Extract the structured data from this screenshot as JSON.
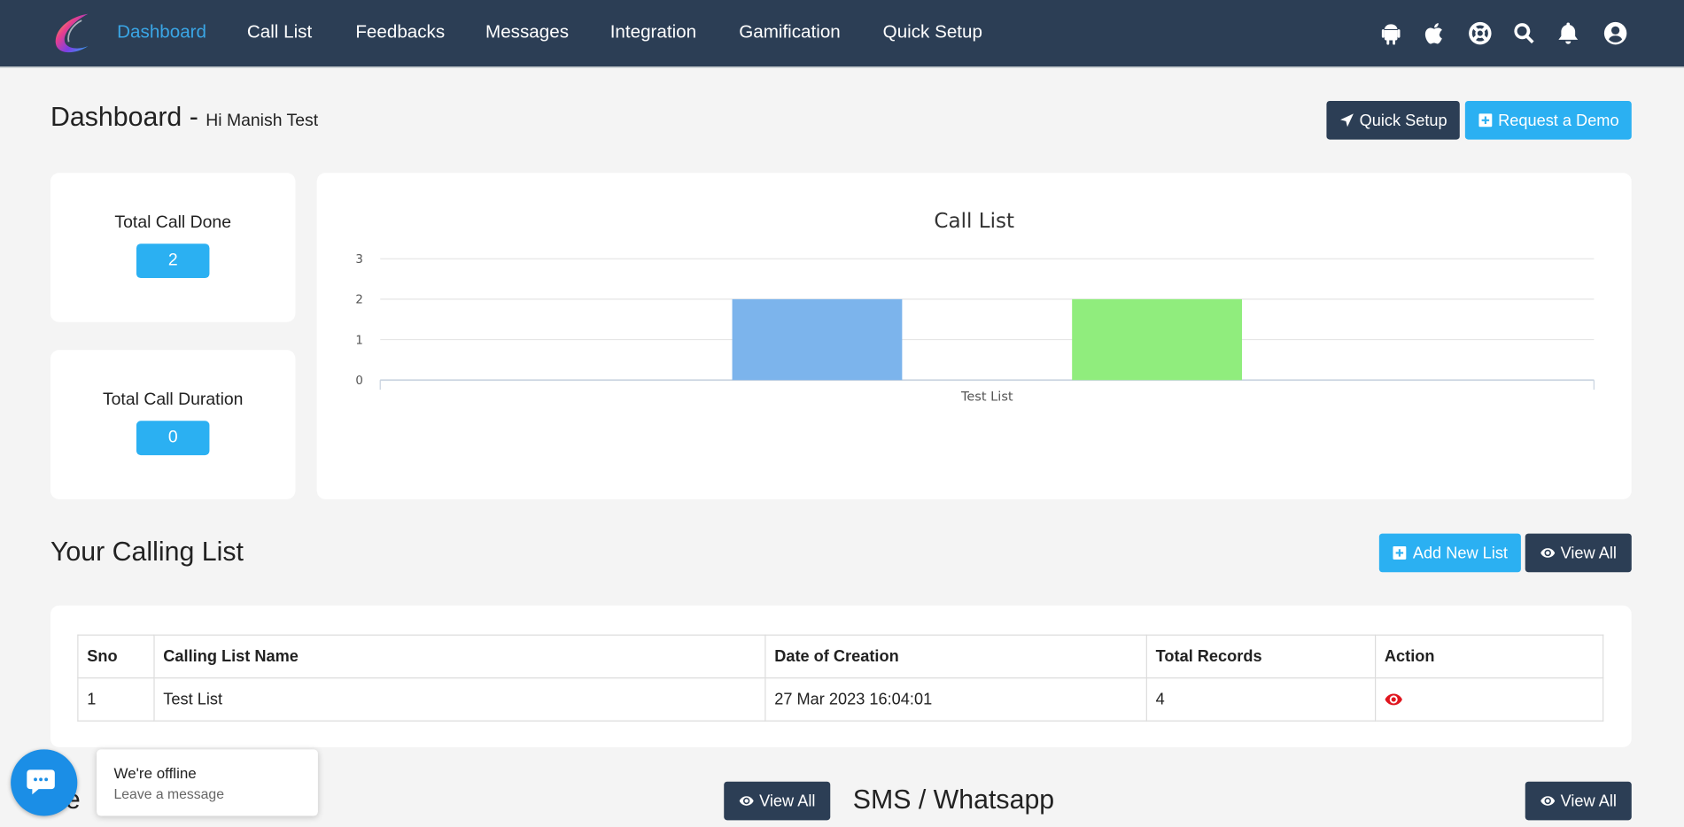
{
  "nav": {
    "items": [
      "Dashboard",
      "Call List",
      "Feedbacks",
      "Messages",
      "Integration",
      "Gamification",
      "Quick Setup"
    ],
    "icons": [
      "android-icon",
      "apple-icon",
      "support-icon",
      "search-icon",
      "bell-icon",
      "user-icon"
    ]
  },
  "header": {
    "title": "Dashboard -",
    "greeting": "Hi Manish Test",
    "quick_setup": "Quick Setup",
    "request_demo": "Request a Demo"
  },
  "stats": {
    "total_call_done_label": "Total Call Done",
    "total_call_done_value": "2",
    "total_call_duration_label": "Total Call Duration",
    "total_call_duration_value": "0"
  },
  "chart_data": {
    "type": "bar",
    "title": "Call List",
    "categories": [
      "Test List"
    ],
    "series": [
      {
        "values": [
          2
        ],
        "color": "#7cb4ec"
      },
      {
        "values": [
          2
        ],
        "color": "#90ed7d"
      }
    ],
    "yticks": [
      "0",
      "1",
      "2",
      "3"
    ],
    "ylim": [
      0,
      3
    ],
    "grid": true
  },
  "calling_list": {
    "title": "Your Calling List",
    "add_new": "Add New List",
    "view_all": "View All",
    "columns": [
      "Sno",
      "Calling List Name",
      "Date of Creation",
      "Total Records",
      "Action"
    ],
    "rows": [
      {
        "sno": "1",
        "name": "Test List",
        "date": "27 Mar 2023 16:04:01",
        "records": "4"
      }
    ]
  },
  "bottom": {
    "feedback_partial": "ee",
    "view_all_left": "View All",
    "sms_title": "SMS / Whatsapp",
    "view_all_right": "View All"
  },
  "chat": {
    "status": "We're offline",
    "prompt": "Leave a message"
  }
}
